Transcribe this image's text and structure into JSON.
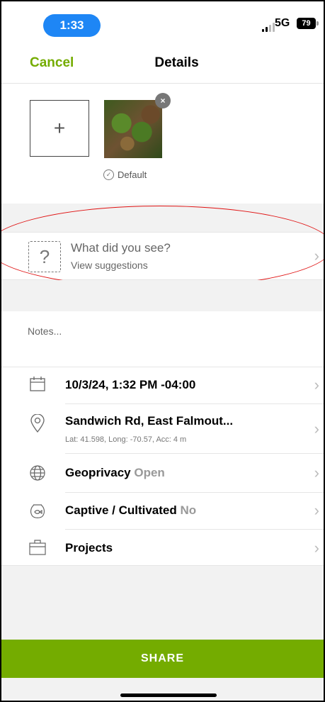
{
  "status_bar": {
    "time": "1:33",
    "network": "5G",
    "battery": "79"
  },
  "header": {
    "cancel_label": "Cancel",
    "title": "Details"
  },
  "photos": {
    "add_label": "+",
    "remove_label": "×",
    "default_label": "Default"
  },
  "suggestion": {
    "icon_text": "?",
    "title": "What did you see?",
    "subtitle": "View suggestions"
  },
  "notes": {
    "placeholder": "Notes..."
  },
  "rows": {
    "date": {
      "label": "10/3/24, 1:32 PM -04:00"
    },
    "location": {
      "label": "Sandwich Rd, East Falmout...",
      "coords": "Lat: 41.598, Long: -70.57, Acc: 4 m"
    },
    "geoprivacy": {
      "label": "Geoprivacy",
      "value": "Open"
    },
    "captive": {
      "label": "Captive / Cultivated",
      "value": "No"
    },
    "projects": {
      "label": "Projects"
    }
  },
  "chevron": "›",
  "share_label": "SHARE",
  "colors": {
    "accent": "#74ac00",
    "time_pill": "#1e86f5",
    "annotation": "#e01414"
  }
}
